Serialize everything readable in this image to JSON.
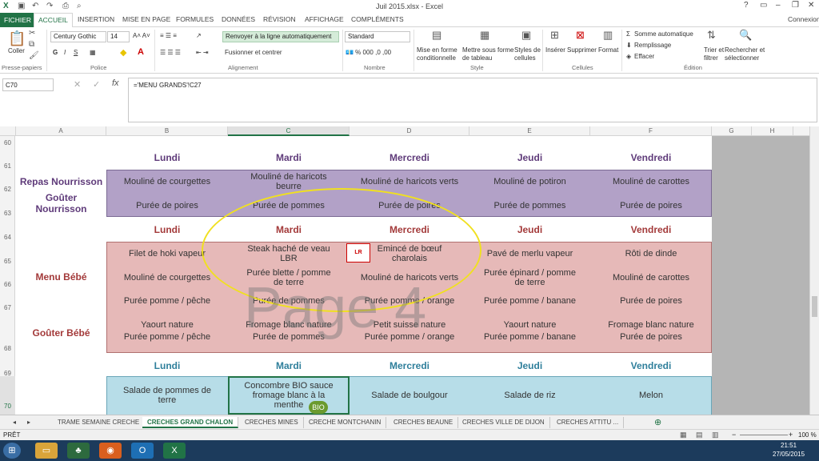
{
  "window": {
    "title": "Juil 2015.xlsx - Excel",
    "help": "?",
    "connexion": "Connexion"
  },
  "tabs": [
    "FICHIER",
    "ACCUEIL",
    "INSERTION",
    "MISE EN PAGE",
    "FORMULES",
    "DONNÉES",
    "RÉVISION",
    "AFFICHAGE",
    "COMPLÉMENTS"
  ],
  "ribbon": {
    "coller": "Coller",
    "presse": "Presse-papiers",
    "font_name": "Century Gothic",
    "font_size": "14",
    "police": "Police",
    "wrap": "Renvoyer à la ligne automatiquement",
    "merge": "Fusionner et centrer",
    "alignement": "Alignement",
    "number_format": "Standard",
    "nombre": "Nombre",
    "mise_forme": "Mise en forme\nconditionnelle",
    "mettre_forme": "Mettre sous forme\nde tableau",
    "styles_cell": "Styles de\ncellules",
    "style": "Style",
    "inserer": "Insérer",
    "supprimer": "Supprimer",
    "format": "Format",
    "cellules": "Cellules",
    "somme": "Somme automatique",
    "remplissage": "Remplissage",
    "effacer": "Effacer",
    "trier": "Trier et\nfiltrer",
    "rechercher": "Rechercher et\nsélectionner",
    "edition": "Édition"
  },
  "formula": {
    "namebox": "C70",
    "fx": "fx",
    "content": "='MENU GRANDS'!C27"
  },
  "columns": [
    "A",
    "B",
    "C",
    "D",
    "E",
    "F",
    "G",
    "H"
  ],
  "rows": [
    "60",
    "61",
    "62",
    "63",
    "64",
    "65",
    "66",
    "67",
    "68",
    "69",
    "70"
  ],
  "days": [
    "Lundi",
    "Mardi",
    "Mercredi",
    "Jeudi",
    "Vendredi"
  ],
  "labels": {
    "repas": "Repas Nourrisson",
    "gouter_nourrisson": "Goûter\nNourrisson",
    "menu_bebe": "Menu Bébé",
    "gouter_bebe": "Goûter Bébé"
  },
  "nourrisson": {
    "row62": [
      "Mouliné de courgettes",
      "Mouliné de haricots\nbeurre",
      "Mouliné de haricots verts",
      "Mouliné de potiron",
      "Mouliné de carottes"
    ],
    "row63": [
      "Purée de poires",
      "Purée de pommes",
      "Purée de poires",
      "Purée de pommes",
      "Purée de poires"
    ]
  },
  "bebe": {
    "row65": [
      "Filet de hoki vapeur",
      "Steak haché de veau\nLBR",
      "Emincé de bœuf\ncharolais",
      "Pavé de merlu vapeur",
      "Rôti de dinde"
    ],
    "row66": [
      "Mouliné de courgettes",
      "Purée blette / pomme\nde terre",
      "Mouliné de haricots verts",
      "Purée épinard / pomme\nde terre",
      "Mouliné de carottes"
    ],
    "row67": [
      "Purée pomme / pêche",
      "Purée de pommes",
      "Purée pomme / orange",
      "Purée pomme / banane",
      "Purée de poires"
    ],
    "row68": [
      "Yaourt nature\nPurée pomme / pêche",
      "Fromage blanc nature\nPurée de pommes",
      "Petit suisse nature\nPurée pomme / orange",
      "Yaourt nature\nPurée pomme / banane",
      "Fromage blanc nature\nPurée de poires"
    ]
  },
  "grands": {
    "row70": [
      "Salade de pommes de\nterre",
      "Concombre BIO sauce\nfromage blanc à la\nmenthe",
      "Salade de boulgour",
      "Salade de riz",
      "Melon"
    ]
  },
  "bio_badge": "BIO",
  "watermark": "Page 4",
  "colors": {
    "purple": "#b2a1c7",
    "pink": "#e6b9b8",
    "blue": "#b7dde8",
    "purple_text": "#5f3b7a",
    "pink_text": "#a33a3a",
    "blue_text": "#2f7f9b",
    "excel_green": "#217346"
  },
  "sheets": [
    "TRAME SEMAINE CRECHE",
    "CRECHES GRAND CHALON",
    "CRECHES MINES",
    "CRECHE MONTCHANIN",
    "CRECHES BEAUNE",
    "CRECHES VILLE DE DIJON",
    "CRECHES ATTITU ..."
  ],
  "status": {
    "ready": "PRÊT",
    "zoom": "100 %"
  },
  "taskbar": {
    "time": "21:51",
    "date": "27/05/2015"
  }
}
